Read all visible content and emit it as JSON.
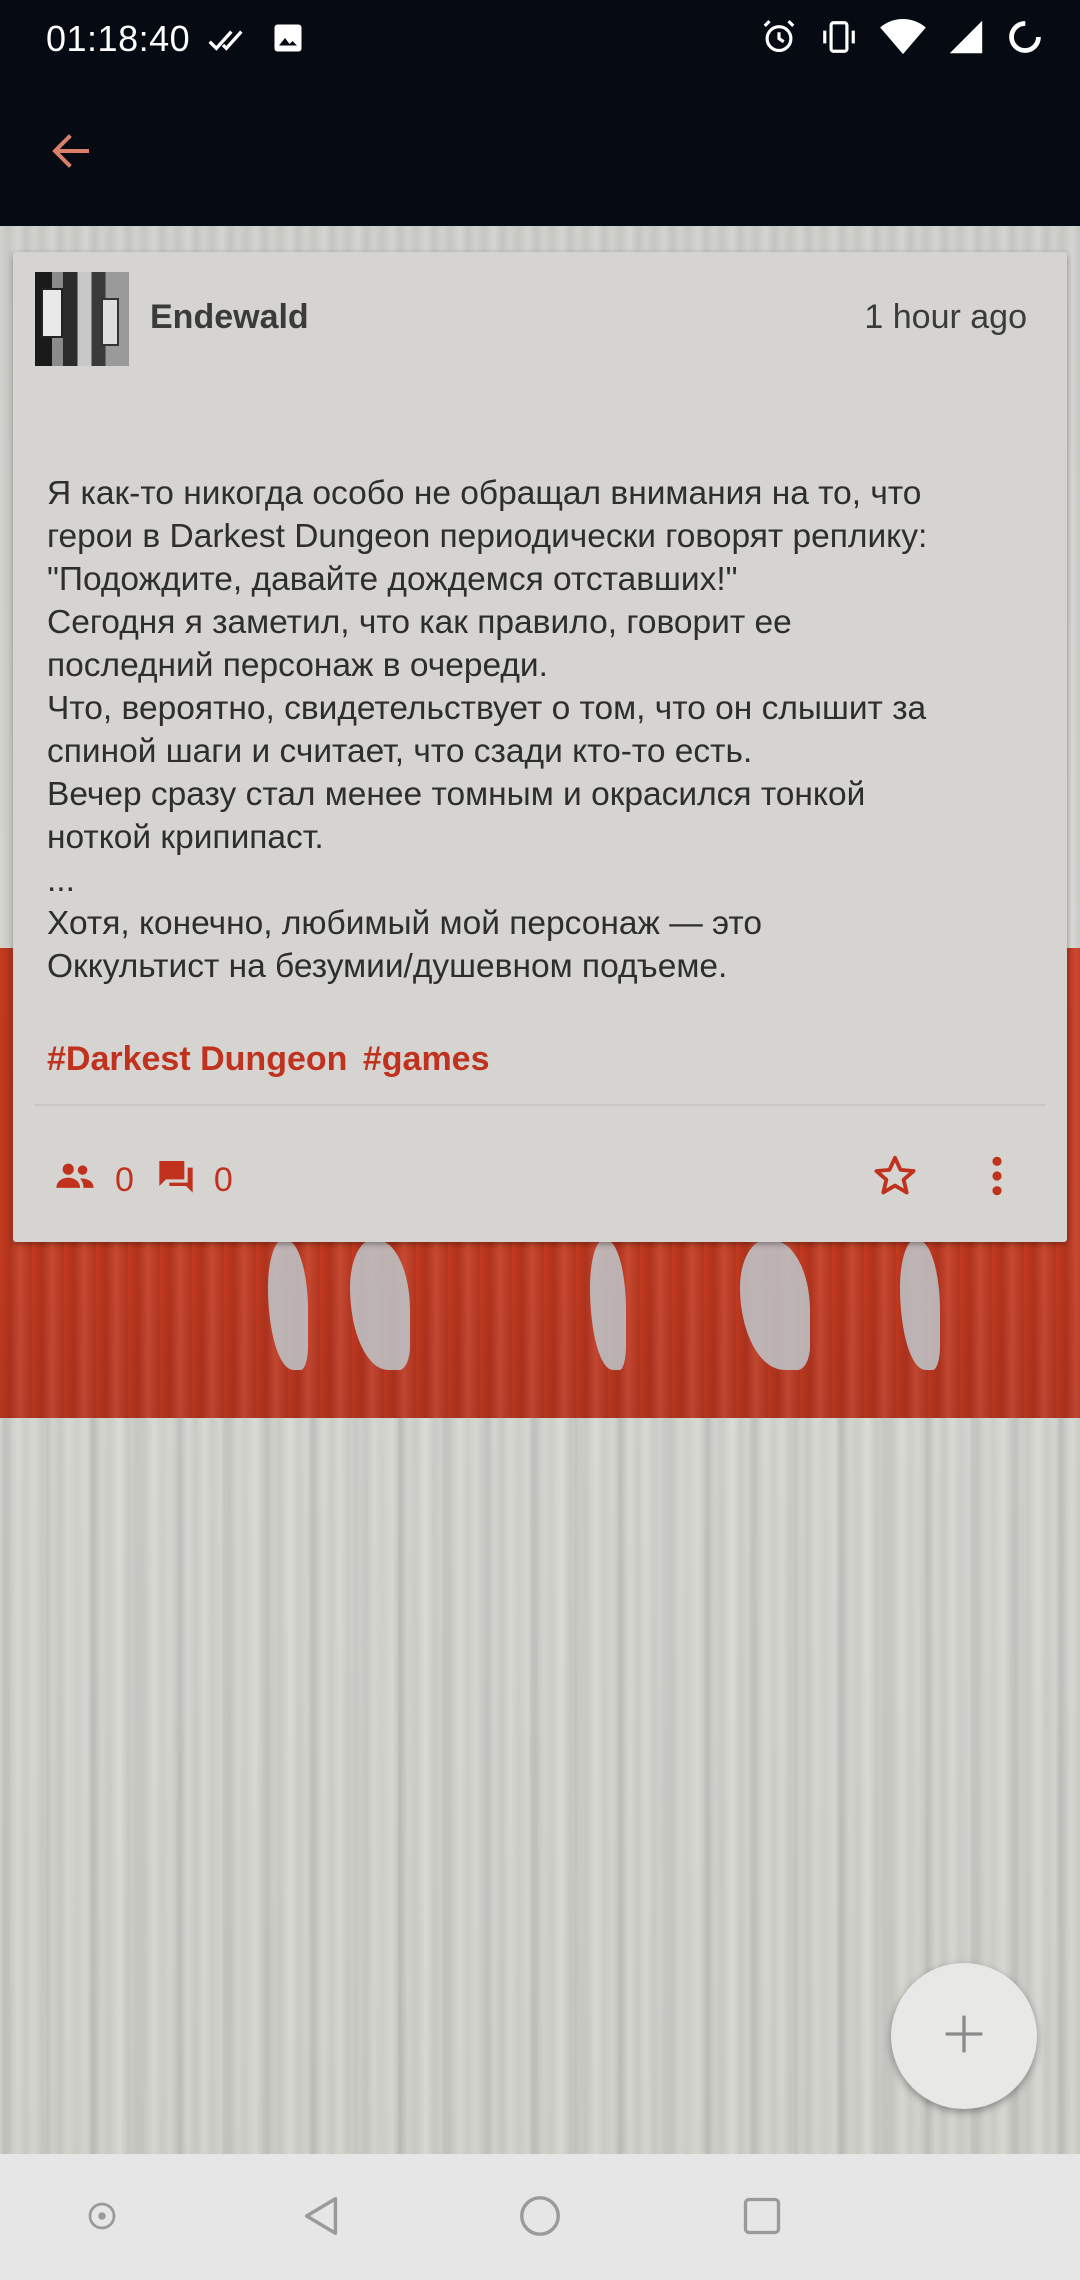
{
  "status_bar": {
    "time": "01:18:40",
    "icons": [
      "double-check-icon",
      "image-icon",
      "alarm-icon",
      "vibrate-icon",
      "wifi-icon",
      "signal-icon",
      "loading-circle-icon"
    ]
  },
  "toolbar": {
    "back_icon": "arrow-left-icon"
  },
  "post": {
    "author": "Endewald",
    "time_ago": "1 hour ago",
    "body_lines": [
      "Я как-то никогда особо не обращал внимания на то, что",
      "герои в Darkest Dungeon периодически говорят реплику:",
      "\"Подождите, давайте дождемся отставших!\"",
      "Сегодня я заметил, что как правило, говорит ее",
      "последний персонаж в очереди.",
      "Что, вероятно, свидетельствует о том, что он слышит за",
      "спиной шаги и считает, что сзади кто-то есть.",
      "Вечер сразу стал менее томным и окрасился тонкой",
      "ноткой крипипаст.",
      "...",
      "Хотя, конечно, любимый мой персонаж — это",
      "Оккультист на безумии/душевном подъеме."
    ],
    "tags": [
      "#Darkest Dungeon",
      "#games"
    ],
    "reshare_count": "0",
    "comment_count": "0"
  },
  "fab": {
    "icon": "plus-icon"
  },
  "nav": {
    "icons": [
      "assist-icon",
      "back-triangle-icon",
      "home-circle-icon",
      "recents-square-icon"
    ]
  },
  "colors": {
    "accent": "#c0321e",
    "bar_bg": "#050a13",
    "card_bg": "#d5d4d1",
    "text": "#2e2e2e"
  }
}
